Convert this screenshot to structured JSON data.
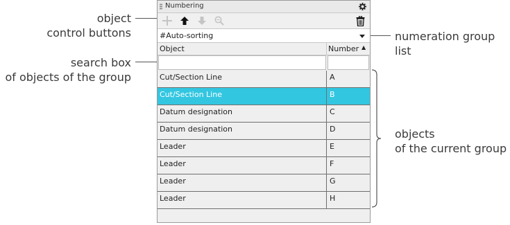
{
  "callouts": {
    "object_control_line1": "object",
    "object_control_line2": "control buttons",
    "search_box_line1": "search box",
    "search_box_line2": "of objects of the group",
    "numeration_line1": "numeration group",
    "numeration_line2": "list",
    "objects_line1": "objects",
    "objects_line2": "of the current group"
  },
  "panel": {
    "title": "Numbering",
    "toolbar": {
      "buttons": [
        "plus-icon",
        "arrow-up-icon",
        "arrow-down-icon",
        "zoom-icon"
      ],
      "delete_icon": "trash-icon"
    },
    "dropdown_value": "#Auto-sorting",
    "columns": {
      "object": "Object",
      "number": "Number",
      "sort_indicator": "▲"
    },
    "rows": [
      {
        "object": "Cut/Section Line",
        "number": "A",
        "selected": false
      },
      {
        "object": "Cut/Section Line",
        "number": "B",
        "selected": true
      },
      {
        "object": "Datum designation",
        "number": "C",
        "selected": false
      },
      {
        "object": "Datum designation",
        "number": "D",
        "selected": false
      },
      {
        "object": "Leader",
        "number": "E",
        "selected": false
      },
      {
        "object": "Leader",
        "number": "F",
        "selected": false
      },
      {
        "object": "Leader",
        "number": "G",
        "selected": false
      },
      {
        "object": "Leader",
        "number": "H",
        "selected": false
      }
    ],
    "selection_color": "#33c6e1"
  }
}
